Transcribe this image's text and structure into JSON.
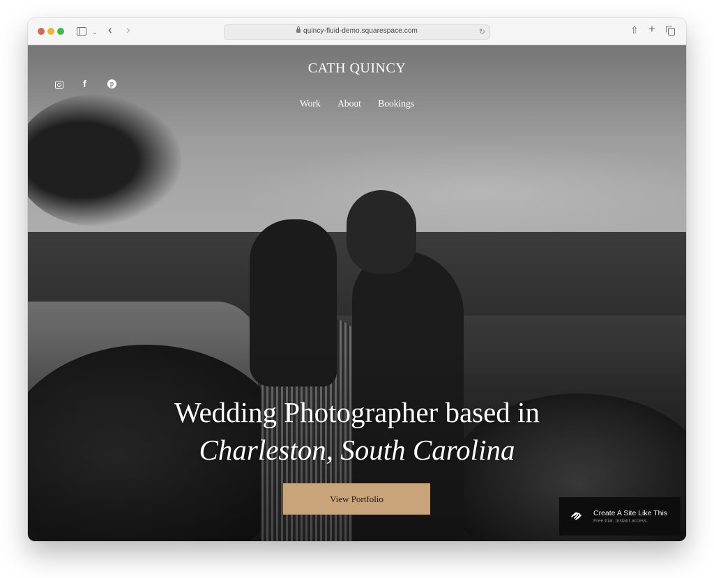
{
  "browser": {
    "url": "quincy-fluid-demo.squarespace.com",
    "icons": {
      "close": "traffic-light-red",
      "minimize": "traffic-light-yellow",
      "maximize": "traffic-light-green",
      "sidebar": "sidebar-icon",
      "sidebar_menu": "chevron-down-icon",
      "back": "chevron-left-icon",
      "forward": "chevron-right-icon",
      "lock": "lock-icon",
      "reload": "reload-icon",
      "share": "share-icon",
      "new_tab": "plus-icon",
      "tabs": "tabs-overview-icon"
    },
    "glyphs": {
      "chevron_down": "⌄",
      "back": "‹",
      "forward": "›",
      "reload": "↻",
      "share": "⇧",
      "plus": "+"
    }
  },
  "site": {
    "title": "CATH QUINCY",
    "nav": [
      {
        "label": "Work"
      },
      {
        "label": "About"
      },
      {
        "label": "Bookings"
      }
    ],
    "social": [
      {
        "name": "instagram",
        "glyph": ""
      },
      {
        "name": "facebook",
        "glyph": "f"
      },
      {
        "name": "pinterest",
        "glyph": "p"
      }
    ]
  },
  "hero": {
    "headline_line1": "Wedding Photographer based in",
    "headline_line2": "Charleston, South Carolina",
    "cta_label": "View Portfolio",
    "cta_color": "#c9a47a"
  },
  "badge": {
    "title": "Create A Site Like This",
    "subtitle": "Free trial. Instant access."
  }
}
